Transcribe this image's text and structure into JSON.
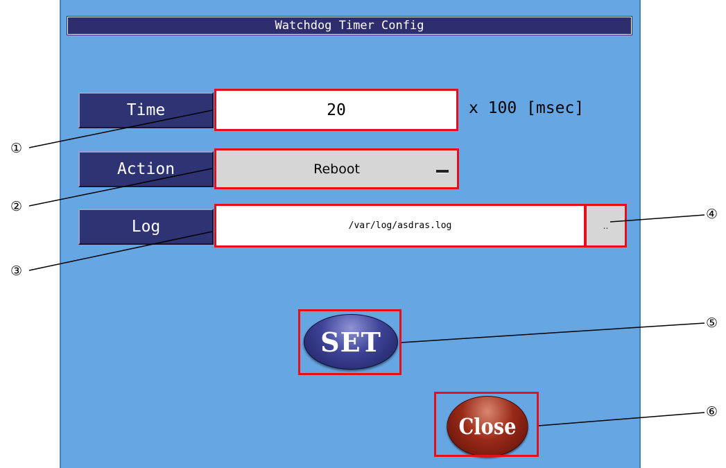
{
  "dialog": {
    "title": "Watchdog Timer Config"
  },
  "time": {
    "label": "Time",
    "value": "20",
    "unit": "x 100 [msec]"
  },
  "action": {
    "label": "Action",
    "selected": "Reboot"
  },
  "log": {
    "label": "Log",
    "path": "/var/log/asdras.log",
    "browse_label": ".."
  },
  "buttons": {
    "set_label": "SET",
    "close_label": "Close"
  },
  "callouts": {
    "m1": "①",
    "m2": "②",
    "m3": "③",
    "m4": "④",
    "m5": "⑤",
    "m6": "⑥"
  },
  "colors": {
    "panel_bg": "#66a6e3",
    "label_bg": "#2e3373",
    "highlight": "#e3101c",
    "set_button": "#2e3373",
    "close_button": "#8b1e10"
  }
}
